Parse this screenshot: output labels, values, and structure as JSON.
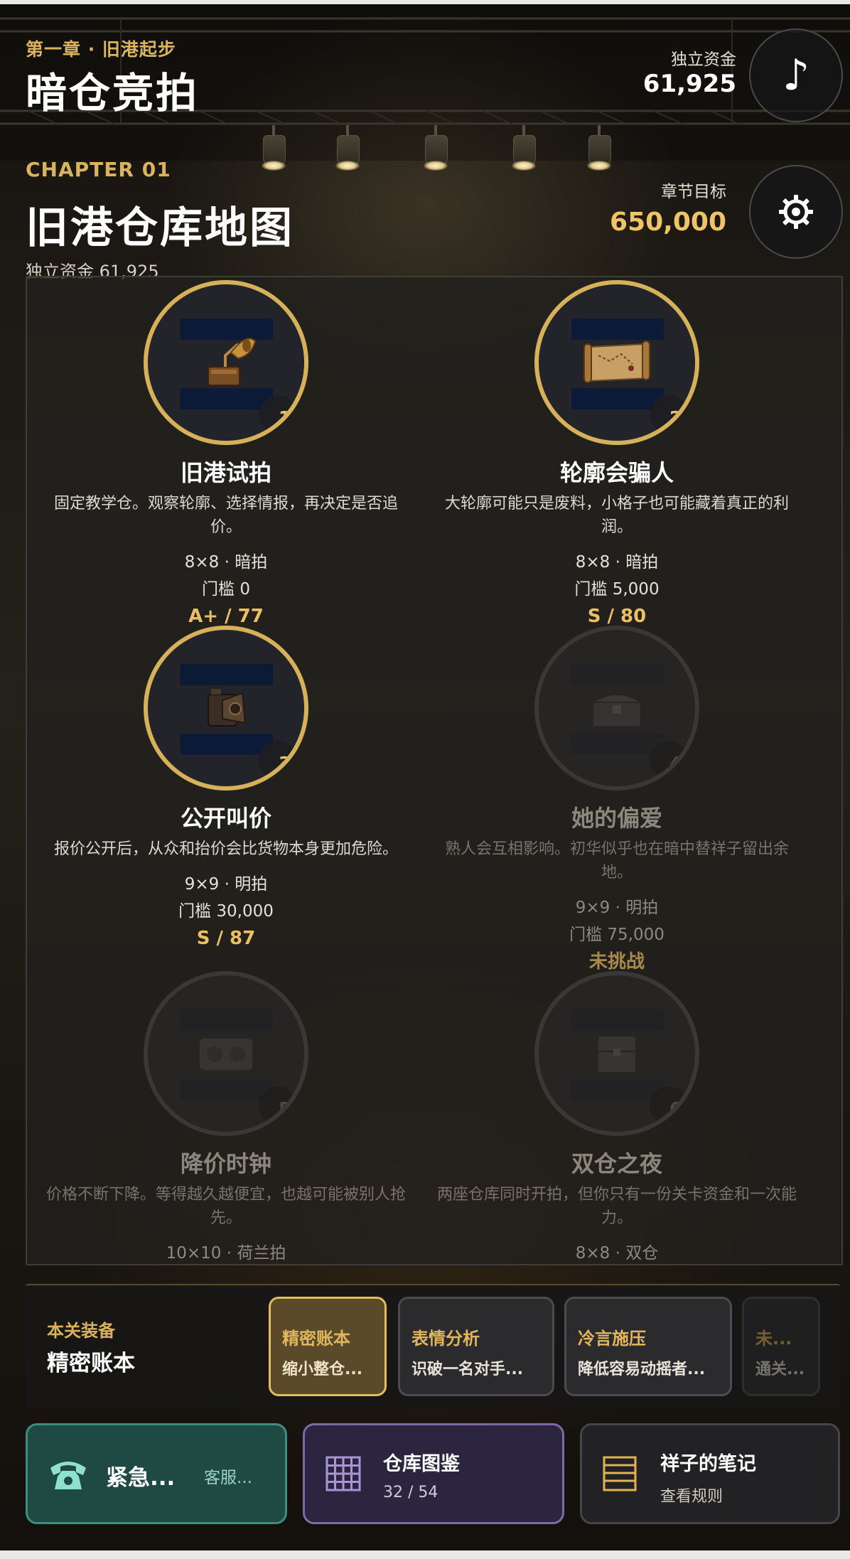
{
  "header": {
    "chapter_label": "第一章 · 旧港起步",
    "title": "暗仓竞拍",
    "funds_label": "独立资金",
    "funds_value": "61,925"
  },
  "chapter": {
    "code": "CHAPTER 01",
    "map_title": "旧港仓库地图",
    "goal_label": "章节目标",
    "goal_value": "650,000",
    "funds_line": "独立资金 61,925"
  },
  "levels": [
    {
      "number": "1",
      "name": "旧港试拍",
      "description": "固定教学仓。观察轮廓、选择情报，再决定是否追价。",
      "grid": "8×8 · 暗拍",
      "threshold": "门槛 0",
      "score": "A+ / 77",
      "icon": "gramophone-icon"
    },
    {
      "number": "2",
      "name": "轮廓会骗人",
      "description": "大轮廓可能只是废料，小格子也可能藏着真正的利润。",
      "grid": "8×8 · 暗拍",
      "threshold": "门槛 5,000",
      "score": "S / 80",
      "icon": "map-scroll-icon"
    },
    {
      "number": "3",
      "name": "公开叫价",
      "description": "报价公开后，从众和抬价会比货物本身更加危险。",
      "grid": "9×9 · 明拍",
      "threshold": "门槛 30,000",
      "score": "S / 87",
      "icon": "camera-icon"
    },
    {
      "number": "4",
      "name": "她的偏爱",
      "description": "熟人会互相影响。初华似乎也在暗中替祥子留出余地。",
      "grid": "9×9 · 明拍",
      "threshold": "门槛 75,000",
      "score": "未挑战",
      "icon": "chest-icon"
    },
    {
      "number": "5",
      "name": "降价时钟",
      "description": "价格不断下降。等得越久越便宜，也越可能被别人抢先。",
      "grid": "10×10 · 荷兰拍",
      "threshold": "",
      "score": "",
      "icon": "radio-icon"
    },
    {
      "number": "6",
      "name": "双仓之夜",
      "description": "两座仓库同时开拍，但你只有一份关卡资金和一次能力。",
      "grid": "8×8 · 双仓",
      "threshold": "",
      "score": "",
      "icon": "crate-icon"
    }
  ],
  "equipment": {
    "label": "本关装备",
    "current": "精密账本",
    "items": [
      {
        "title": "精密账本",
        "subtitle": "缩小整仓..."
      },
      {
        "title": "表情分析",
        "subtitle": "识破一名对手..."
      },
      {
        "title": "冷言施压",
        "subtitle": "降低容易动摇者..."
      },
      {
        "title": "未...",
        "subtitle": "通关..."
      }
    ]
  },
  "bottom": {
    "hotline_label": "紧急...",
    "hotline_sub": "客服...",
    "atlas_title": "仓库图鉴",
    "atlas_count": "32 / 54",
    "notes_title": "祥子的笔记",
    "notes_sub": "查看规则"
  },
  "colors": {
    "accent_gold": "#d9b35e",
    "score_gold": "#ecc062",
    "hotline_teal": "#1f4a44",
    "atlas_purple": "#2c2540"
  }
}
